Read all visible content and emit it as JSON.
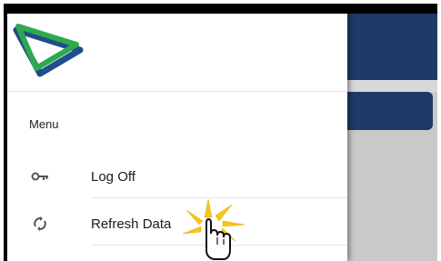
{
  "drawer": {
    "section_label": "Menu",
    "items": [
      {
        "label": "Log Off",
        "icon": "key-icon"
      },
      {
        "label": "Refresh Data",
        "icon": "refresh-icon"
      }
    ]
  },
  "colors": {
    "header_blue": "#1d3b66",
    "logo_green": "#2fa84f",
    "logo_blue": "#1f4e8c",
    "click_highlight": "#f5c518"
  }
}
